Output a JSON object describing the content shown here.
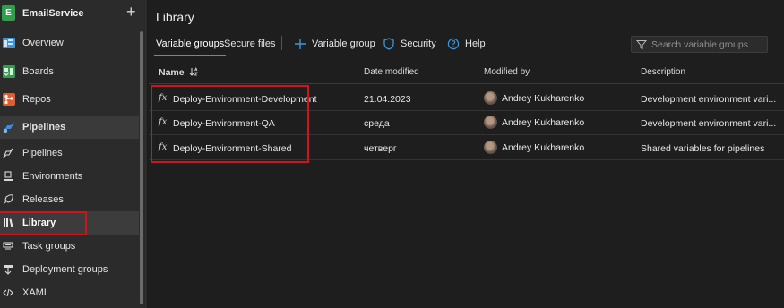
{
  "project": {
    "badge": "E",
    "name": "EmailService",
    "add": "+"
  },
  "sidebar": {
    "items": [
      {
        "label": "Overview",
        "icon": "overview-icon",
        "color": "#3a96dd"
      },
      {
        "label": "Boards",
        "icon": "boards-icon",
        "color": "#2e9f4a"
      },
      {
        "label": "Repos",
        "icon": "repos-icon",
        "color": "#e25d2c"
      },
      {
        "label": "Pipelines",
        "icon": "pipelines-icon",
        "color": "#3a8ee6"
      },
      {
        "label": "Pipelines",
        "icon": "pipelines-sub-icon"
      },
      {
        "label": "Environments",
        "icon": "environments-icon"
      },
      {
        "label": "Releases",
        "icon": "releases-icon"
      },
      {
        "label": "Library",
        "icon": "library-icon"
      },
      {
        "label": "Task groups",
        "icon": "task-groups-icon"
      },
      {
        "label": "Deployment groups",
        "icon": "deployment-groups-icon"
      },
      {
        "label": "XAML",
        "icon": "xaml-icon"
      }
    ]
  },
  "main": {
    "title": "Library",
    "tabs": [
      {
        "label": "Variable groups",
        "active": true
      },
      {
        "label": "Secure files",
        "active": false
      }
    ],
    "toolbar": {
      "add_label": "Variable group",
      "security_label": "Security",
      "help_label": "Help"
    },
    "search": {
      "placeholder": "Search variable groups"
    },
    "columns": [
      "Name",
      "Date modified",
      "Modified by",
      "Description"
    ],
    "rows": [
      {
        "name": "Deploy-Environment-Development",
        "date": "21.04.2023",
        "user": "Andrey Kukharenko",
        "description": "Development environment vari..."
      },
      {
        "name": "Deploy-Environment-QA",
        "date": "среда",
        "user": "Andrey Kukharenko",
        "description": "Development environment vari..."
      },
      {
        "name": "Deploy-Environment-Shared",
        "date": "четверг",
        "user": "Andrey Kukharenko",
        "description": "Shared variables for pipelines"
      }
    ],
    "fx_symbol": "fx"
  },
  "colors": {
    "accent": "#3a96dd",
    "highlight": "#d0141c",
    "background": "#1e1e1e",
    "sidebar": "#2b2b2b"
  }
}
